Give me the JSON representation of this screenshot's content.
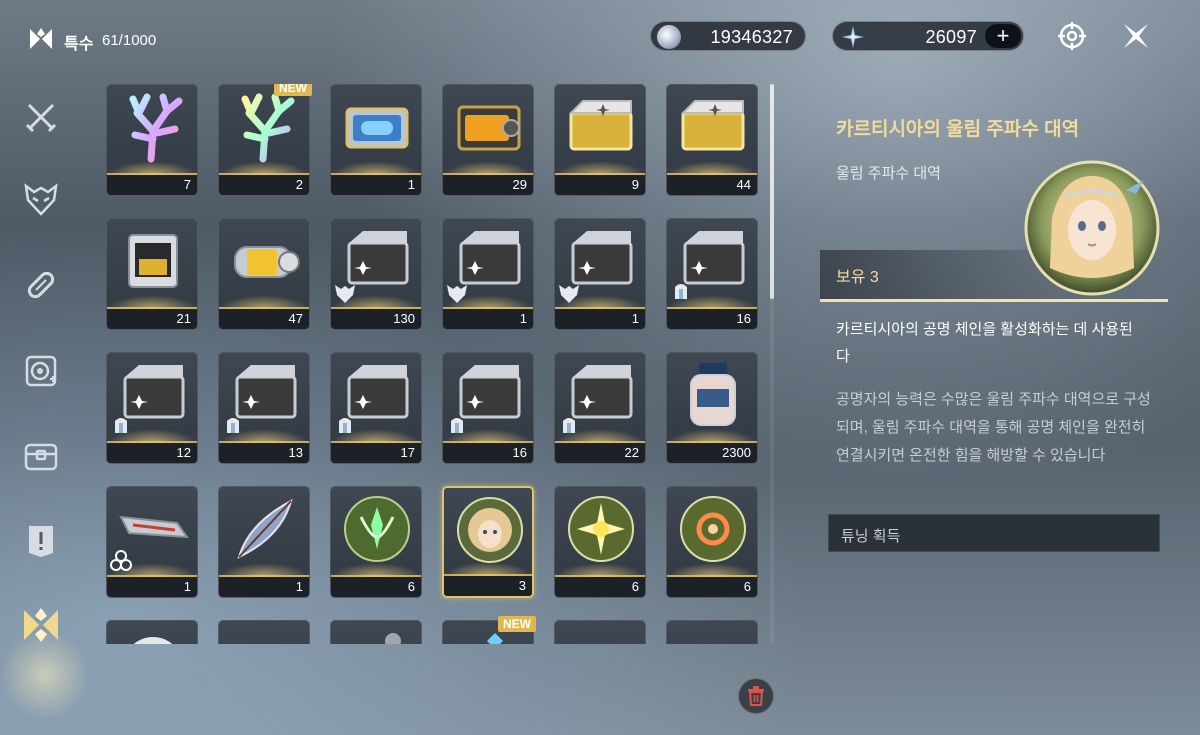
{
  "header": {
    "category_title": "특수",
    "category_count": "61/1000",
    "currency_1": "19346327",
    "currency_2": "26097",
    "plus_label": "+"
  },
  "grid": {
    "new_tag": "NEW",
    "rows": [
      [
        "7",
        "2",
        "1",
        "29",
        "9",
        "44"
      ],
      [
        "21",
        "47",
        "130",
        "1",
        "1",
        "16"
      ],
      [
        "12",
        "13",
        "17",
        "16",
        "22",
        "2300"
      ],
      [
        "1",
        "1",
        "6",
        "3",
        "6",
        "6"
      ]
    ]
  },
  "detail": {
    "title": "카르티시아의 울림 주파수 대역",
    "type": "울림 주파수 대역",
    "hold": "보유 3",
    "description": "카르티시아의 공명 체인을 활성화하는 데 사용된다",
    "lore": "공명자의 능력은 수많은 울림 주파수 대역으로 구성되며, 울림 주파수 대역을 통해 공명 체인을 완전히 연결시키면 온전한 힘을 해방할 수 있습니다",
    "acquire_button": "튜닝 획득"
  },
  "colors": {
    "accent_gold": "#e2c36a",
    "title_gold": "#f1dc9a",
    "new_tag": "#e0b84e"
  }
}
